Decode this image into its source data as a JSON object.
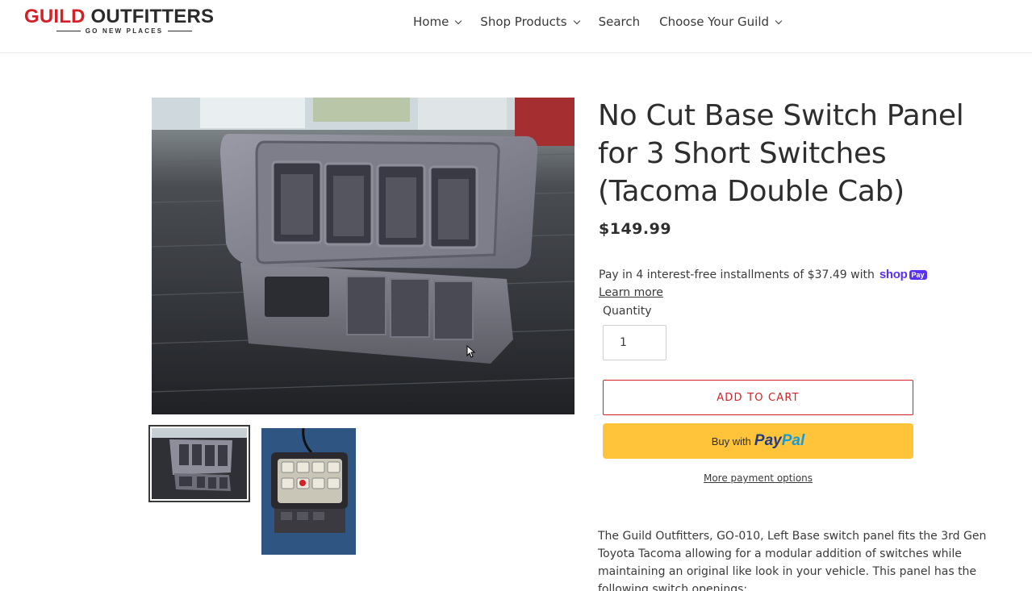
{
  "header": {
    "logo": {
      "brand_red": "GUILD",
      "brand_dark": "OUTFITTERS",
      "tagline": "GO NEW PLACES"
    },
    "nav": [
      {
        "label": "Home",
        "has_dropdown": true
      },
      {
        "label": "Shop Products",
        "has_dropdown": true
      },
      {
        "label": "Search",
        "has_dropdown": false
      },
      {
        "label": "Choose Your Guild",
        "has_dropdown": true
      }
    ]
  },
  "product": {
    "title": "No Cut Base Switch Panel for 3 Short Switches (Tacoma Double Cab)",
    "price": "$149.99",
    "installments_text": "Pay in 4 interest-free installments of $37.49 with",
    "shop_pay": {
      "shop": "shop",
      "pay": "Pay"
    },
    "learn_more": "Learn more",
    "quantity_label": "Quantity",
    "quantity_value": "1",
    "add_to_cart": "ADD TO CART",
    "paypal": {
      "buy_with": "Buy with",
      "pay": "Pay",
      "pal": "Pal"
    },
    "more_payment_options": "More payment options",
    "description": "The Guild Outfitters, GO-010, Left Base switch panel fits the 3rd Gen Toyota Tacoma allowing for a modular addition of switches while maintaining an original like look in your vehicle. This panel has the following switch openings:"
  },
  "colors": {
    "brand_red": "#d42027",
    "text": "#3a3a3a",
    "paypal_yellow": "#ffc439",
    "shop_pay_purple": "#5a31f4"
  }
}
